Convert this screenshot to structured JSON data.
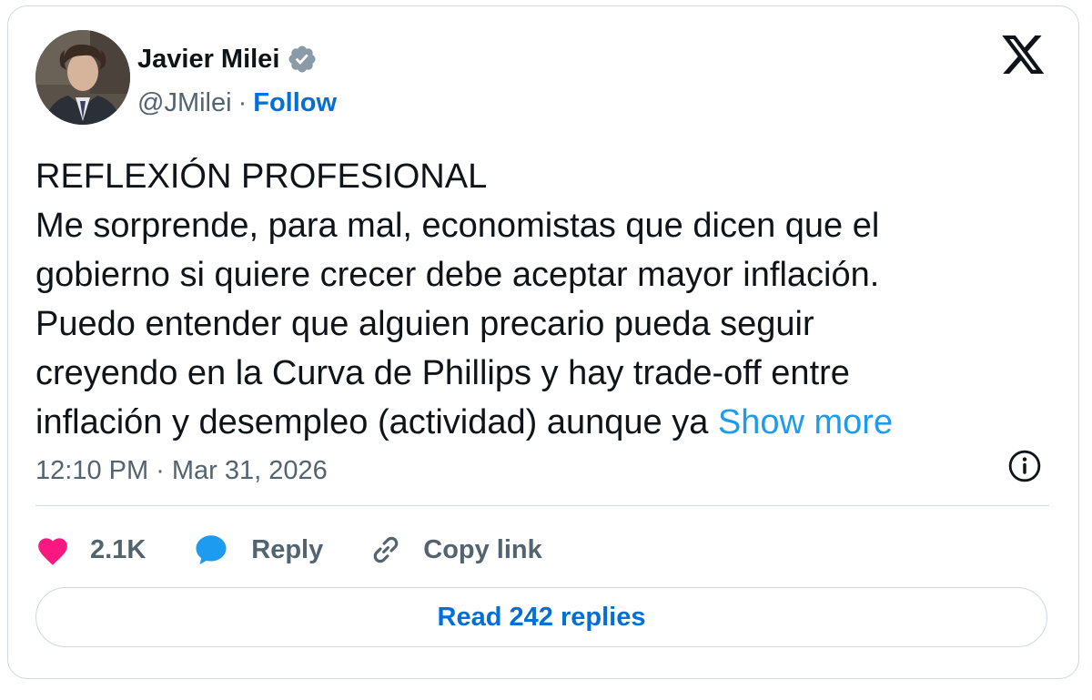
{
  "author": {
    "display_name": "Javier Milei",
    "handle": "@JMilei",
    "separator": "·",
    "follow_label": "Follow"
  },
  "tweet": {
    "lines": [
      "REFLEXIÓN PROFESIONAL",
      "Me sorprende, para mal, economistas que dicen que el",
      "gobierno si quiere crecer debe aceptar mayor inflación.",
      "Puedo entender que alguien precario pueda seguir",
      "creyendo en la Curva de Phillips y hay trade-off entre",
      "inflación y desempleo (actividad) aunque ya "
    ],
    "show_more_label": "Show more",
    "timestamp": "12:10 PM · Mar 31, 2026"
  },
  "actions": {
    "like_count": "2.1K",
    "reply_label": "Reply",
    "copy_link_label": "Copy link"
  },
  "read_replies_label": "Read 242 replies",
  "icons": {
    "verified": "verified-badge-icon",
    "x_logo": "x-logo-icon",
    "info": "info-icon",
    "like": "heart-icon",
    "reply": "speech-bubble-icon",
    "copy_link": "link-icon"
  },
  "colors": {
    "text": "#0f1419",
    "muted": "#536471",
    "link": "#1d9bf0",
    "follow": "#006fd6",
    "heart": "#f91880",
    "border": "#cfd9de"
  }
}
